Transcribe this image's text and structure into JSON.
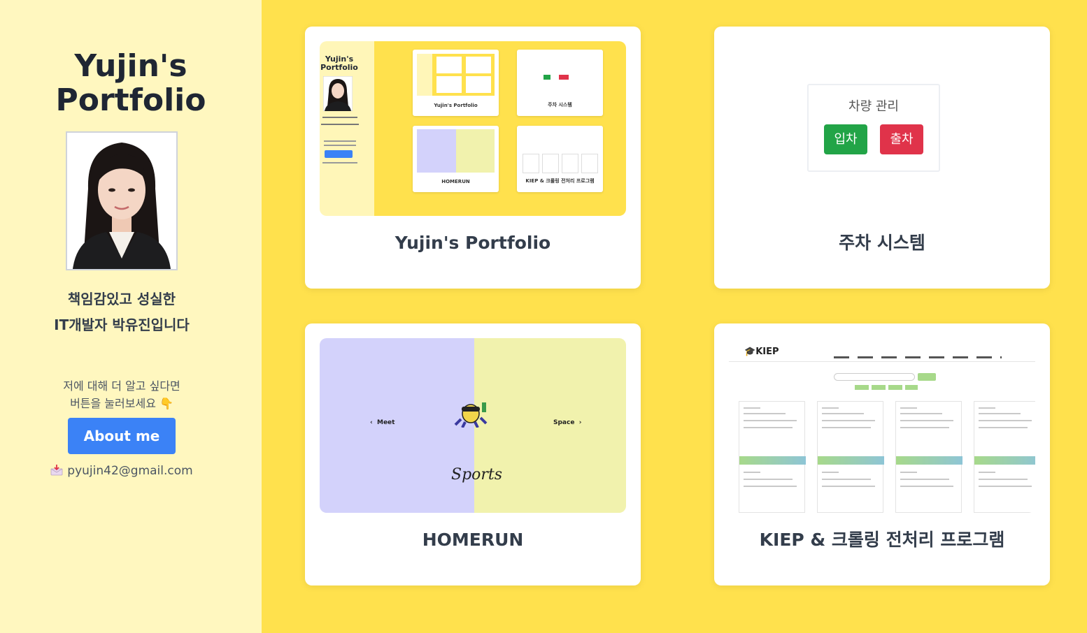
{
  "sidebar": {
    "title_line1": "Yujin's",
    "title_line2": "Portfolio",
    "intro_line1": "책임감있고 성실한",
    "intro_line2": "IT개발자 박유진입니다",
    "more_line1": "저에 대해 더 알고 싶다면",
    "more_line2": "버튼을 눌러보세요 👇",
    "about_button": "About me",
    "email": "pyujin42@gmail.com"
  },
  "projects": [
    {
      "title": "Yujin's Portfolio",
      "preview": {
        "mini_title": "Yujin's Portfolio",
        "mini_cards": [
          "Yujin's Portfolio",
          "주차 시스템",
          "HOMERUN",
          "KIEP & 크롤링 전처리 프로그램"
        ]
      }
    },
    {
      "title": "주차 시스템",
      "preview": {
        "heading": "차량 관리",
        "enter_button": "입차",
        "exit_button": "출차"
      }
    },
    {
      "title": "HOMERUN",
      "preview": {
        "left_nav": "Meet",
        "right_nav": "Space",
        "wordmark": "Sports"
      }
    },
    {
      "title": "KIEP & 크롤링 전처리 프로그램",
      "preview": {
        "logo": "KIEP"
      }
    }
  ],
  "colors": {
    "page_bg": "#ffe14d",
    "sidebar_bg": "#fff7bf",
    "button_blue": "#3b82f6",
    "green_button": "#22a447",
    "red_button": "#e0334a",
    "homerun_left": "#d3d2fb",
    "homerun_right": "#f1f2ad"
  },
  "icons": {
    "email": "inbox-tray-icon",
    "pointer": "pointing-down-emoji"
  }
}
